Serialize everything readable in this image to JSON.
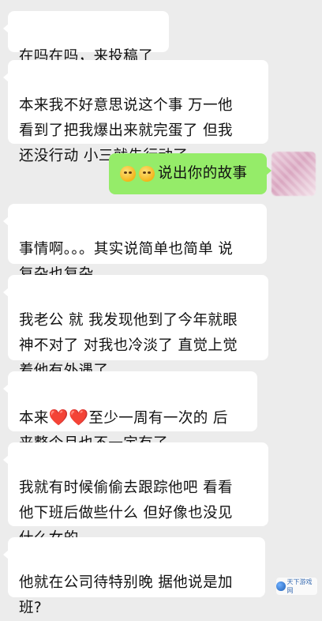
{
  "messages": [
    {
      "side": "in",
      "text": "在吗在吗，来投稿了"
    },
    {
      "side": "in",
      "text": "本来我不好意思说这个事 万一他\n看到了把我爆出来就完蛋了 但我\n还没行动 小三就先行动了"
    },
    {
      "side": "out",
      "text": "说出你的故事",
      "emoji": "dizzy-face-emoji"
    },
    {
      "side": "in",
      "text": "事情啊。。。其实说简单也简单 说\n复杂也复杂。。。"
    },
    {
      "side": "in",
      "text": "我老公 就 我发现他到了今年就眼\n神不对了 对我也冷淡了 直觉上觉\n着他有外遇了"
    },
    {
      "side": "in",
      "text_before": "本来",
      "hearts": "❤️❤️",
      "text_after": "至少一周有一次的 后\n来整个月也不一定有了"
    },
    {
      "side": "in",
      "text": "我就有时候偷偷去跟踪他吧 看看\n他下班后做些什么 但好像也没见\n什么女的"
    },
    {
      "side": "in",
      "text": "他就在公司待特别晚 据他说是加\n班?"
    }
  ],
  "watermark": {
    "text": "天下游戏网",
    "icon": "site-logo-icon"
  },
  "colors": {
    "background": "#ececec",
    "bubble_in": "#ffffff",
    "bubble_out": "#95ec69",
    "heart": "#e5222b"
  }
}
